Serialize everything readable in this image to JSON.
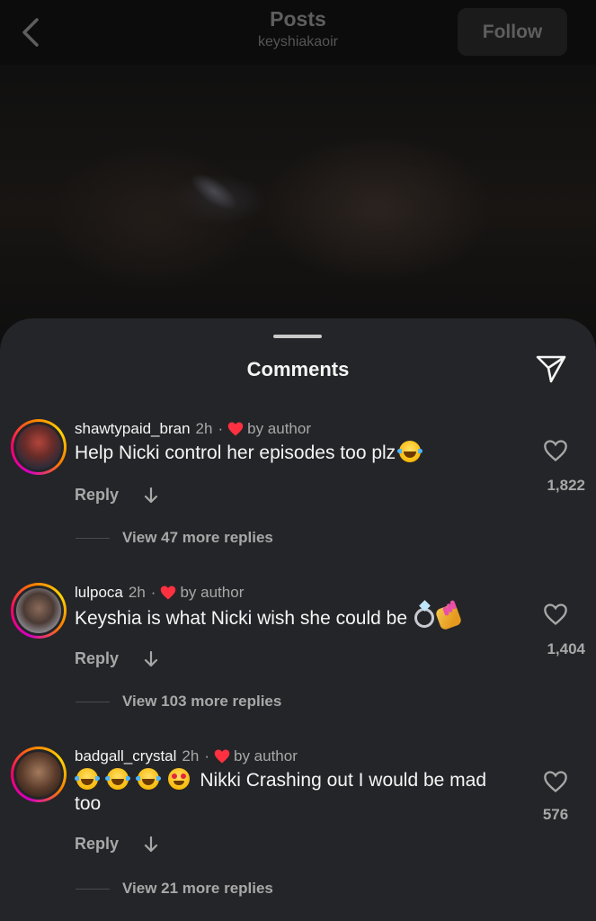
{
  "header": {
    "title": "Posts",
    "subtitle": "keyshiakaoir",
    "follow_label": "Follow"
  },
  "sheet": {
    "title": "Comments"
  },
  "icons": {
    "back": "chevron-left-icon",
    "share": "paper-plane-icon",
    "like": "heart-outline-icon",
    "liked_by_author": "heart-filled-icon",
    "reply": "arrow-down-icon"
  },
  "colors": {
    "background": "#242528",
    "author_heart": "#ff3040",
    "muted_text": "#a8a8a8"
  },
  "comments": [
    {
      "username": "shawtypaid_bran",
      "time": "2h",
      "separator": "·",
      "liked_label": "by author",
      "text": "Help Nicki control her episodes too plz",
      "emojis": [
        "face-with-tears-of-joy"
      ],
      "reply_label": "Reply",
      "likes": "1,822",
      "view_replies": "View 47 more replies"
    },
    {
      "username": "lulpoca",
      "time": "2h",
      "separator": "·",
      "liked_label": "by author",
      "text": "Keyshia is what Nicki wish she could be",
      "emojis": [
        "ring",
        "nail-polish"
      ],
      "reply_label": "Reply",
      "likes": "1,404",
      "view_replies": "View 103 more replies"
    },
    {
      "username": "badgall_crystal",
      "time": "2h",
      "separator": "·",
      "liked_label": "by author",
      "text_line1": "Nikki Crashing out I would be mad",
      "text_line2": "too",
      "emojis": [
        "face-with-tears-of-joy",
        "face-with-tears-of-joy",
        "face-with-tears-of-joy",
        "smiling-face-with-heart-eyes"
      ],
      "reply_label": "Reply",
      "likes": "576",
      "view_replies": "View 21 more replies"
    }
  ]
}
